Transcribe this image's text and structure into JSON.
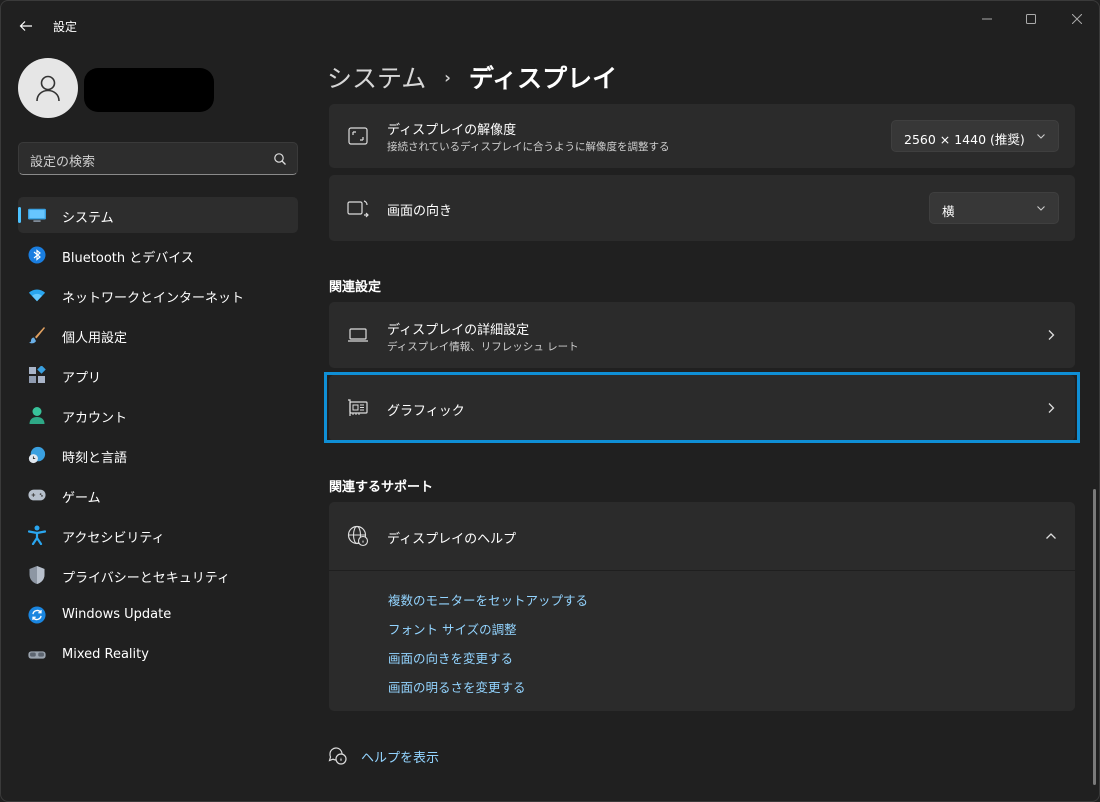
{
  "window": {
    "title": "設定"
  },
  "user": {
    "avatar_icon": "person-icon"
  },
  "search": {
    "placeholder": "設定の検索"
  },
  "sidebar": {
    "items": [
      {
        "label": "システム",
        "icon": "system-display-icon",
        "active": true
      },
      {
        "label": "Bluetooth とデバイス",
        "icon": "bluetooth-icon"
      },
      {
        "label": "ネットワークとインターネット",
        "icon": "wifi-icon"
      },
      {
        "label": "個人用設定",
        "icon": "brush-icon"
      },
      {
        "label": "アプリ",
        "icon": "apps-icon"
      },
      {
        "label": "アカウント",
        "icon": "account-icon"
      },
      {
        "label": "時刻と言語",
        "icon": "time-language-icon"
      },
      {
        "label": "ゲーム",
        "icon": "gamepad-icon"
      },
      {
        "label": "アクセシビリティ",
        "icon": "accessibility-icon"
      },
      {
        "label": "プライバシーとセキュリティ",
        "icon": "shield-icon"
      },
      {
        "label": "Windows Update",
        "icon": "windows-update-icon"
      },
      {
        "label": "Mixed Reality",
        "icon": "mixed-reality-icon"
      }
    ]
  },
  "breadcrumb": {
    "parent": "システム",
    "separator": "›",
    "current": "ディスプレイ"
  },
  "main": {
    "resolution": {
      "title": "ディスプレイの解像度",
      "subtitle": "接続されているディスプレイに合うように解像度を調整する",
      "value": "2560 × 1440 (推奨)"
    },
    "orientation": {
      "title": "画面の向き",
      "value": "横"
    },
    "related_settings": {
      "heading": "関連設定",
      "advanced": {
        "title": "ディスプレイの詳細設定",
        "subtitle": "ディスプレイ情報、リフレッシュ レート"
      },
      "graphics": {
        "title": "グラフィック"
      }
    },
    "related_support": {
      "heading": "関連するサポート",
      "help_title": "ディスプレイのヘルプ",
      "links": [
        "複数のモニターをセットアップする",
        "フォント サイズの調整",
        "画面の向きを変更する",
        "画面の明るさを変更する"
      ]
    },
    "get_help": "ヘルプを表示"
  },
  "colors": {
    "accent": "#4cc2ff",
    "link": "#93d4ff",
    "highlight": "#0f8fd6",
    "background": "#202020",
    "card": "#2b2b2b"
  }
}
